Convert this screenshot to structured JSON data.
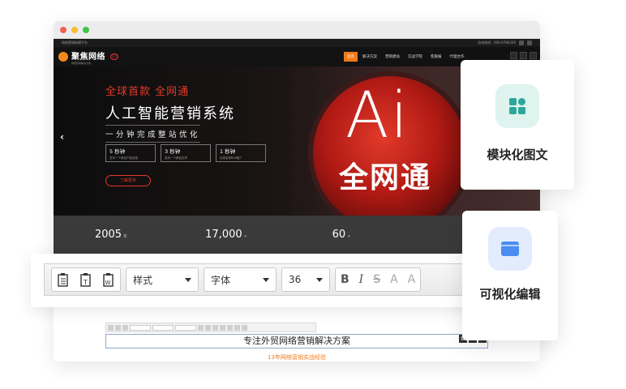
{
  "site": {
    "topbar_left": "网络营销新模平台",
    "topbar_right": "咨询热线：400-6786206",
    "logo_name": "聚焦网络",
    "logo_sub": "网络营销解决方案",
    "menu": [
      {
        "label": "首页",
        "active": true
      },
      {
        "label": "解决方案",
        "active": false
      },
      {
        "label": "营销建站",
        "active": false
      },
      {
        "label": "实战学院",
        "active": false
      },
      {
        "label": "客服报",
        "active": false
      },
      {
        "label": "代理合作",
        "active": false
      }
    ]
  },
  "hero": {
    "tag": "全球首款 全网通",
    "title": "人工智能营销系统",
    "subtitle": "一分钟完成整站优化",
    "boxes": [
      {
        "title": "5 秒钟",
        "desc": "发布一个原创产品信息"
      },
      {
        "title": "3 秒钟",
        "desc": "发布一个原创文章"
      },
      {
        "title": "1 秒钟",
        "desc": "实现全球B2B推广"
      }
    ],
    "button": "了解更多",
    "ai_text": "Ai",
    "ai_cn": "全网通"
  },
  "stats": [
    {
      "value": "2005",
      "unit": "年"
    },
    {
      "value": "17,000",
      "unit": "+"
    },
    {
      "value": "60",
      "unit": "+"
    }
  ],
  "content": {
    "heading": "专注外贸网络营销解决方案",
    "subheading": "13年网络营销实战经验"
  },
  "editor": {
    "style_label": "样式",
    "font_label": "字体",
    "size_label": "36"
  },
  "cards": {
    "module": "模块化图文",
    "visual": "可视化编辑"
  },
  "colors": {
    "accent_orange": "#f07a1a",
    "hero_red": "#e03a2a",
    "module_green": "#2ba89a",
    "visual_blue": "#4a8cf0"
  }
}
